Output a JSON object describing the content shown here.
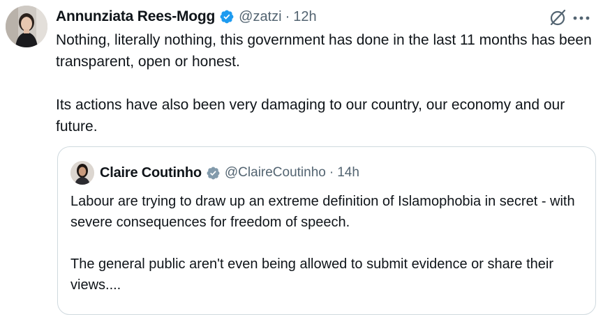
{
  "tweet": {
    "author_name": "Annunziata Rees-Mogg",
    "handle": "@zatzi",
    "separator": "·",
    "time": "12h",
    "text": "Nothing, literally nothing, this government has done in the last 11 months has been transparent, open or honest.\n\nIts actions have also been very damaging to our country, our economy and our future."
  },
  "quoted_tweet": {
    "author_name": "Claire Coutinho",
    "handle": "@ClaireCoutinho",
    "separator": "·",
    "time": "14h",
    "text": "Labour are trying to draw up an extreme definition of Islamophobia in secret - with severe consequences for freedom of speech.\n\nThe general public aren't even being allowed to submit evidence or share their views...."
  },
  "icons": {
    "verified": "verified-badge-icon",
    "grok": "grok-icon",
    "more": "more-options-icon"
  },
  "colors": {
    "text_primary": "#0f1419",
    "text_secondary": "#536471",
    "verified_blue": "#1d9bf0",
    "border": "#cfd9de"
  }
}
